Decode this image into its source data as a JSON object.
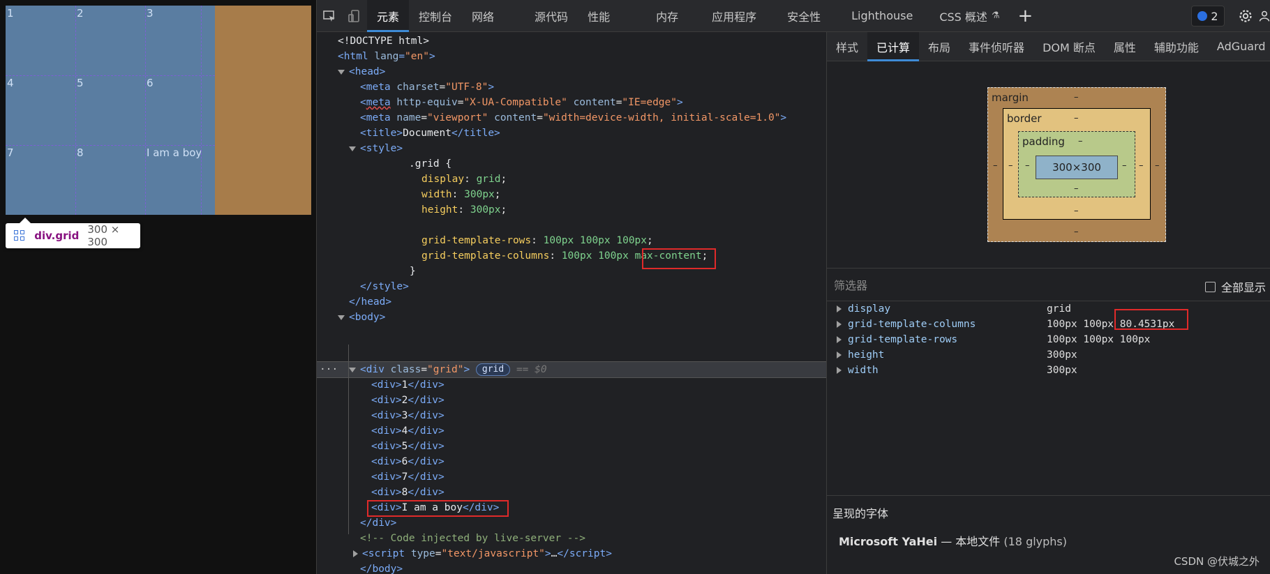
{
  "viewport": {
    "cells": [
      "1",
      "2",
      "3",
      "4",
      "5",
      "6",
      "7",
      "8",
      "I am a boy"
    ],
    "tooltip": {
      "name": "div.grid",
      "size": "300 × 300"
    }
  },
  "toolbar": {
    "tabs": [
      "元素",
      "控制台",
      "网络",
      "源代码",
      "性能",
      "内存",
      "应用程序",
      "安全性",
      "Lighthouse",
      "CSS 概述"
    ],
    "active_tab": "元素",
    "messages_count": "2"
  },
  "dom": {
    "doctype": "<!DOCTYPE html>",
    "html_open": "html",
    "html_lang_attr": "lang",
    "html_lang_val": "\"en\"",
    "meta1_attr": "charset",
    "meta1_val": "\"UTF-8\"",
    "meta2_attr1": "http-equiv",
    "meta2_val1": "\"X-UA-Compatible\"",
    "meta2_attr2": "content",
    "meta2_val2": "\"IE=edge\"",
    "meta3_attr1": "name",
    "meta3_val1": "\"viewport\"",
    "meta3_attr2": "content",
    "meta3_val2": "\"width=device-width, initial-scale=1.0\"",
    "title_text": "Document",
    "css_selector": ".grid {",
    "css": [
      {
        "prop": "display",
        "val": "grid"
      },
      {
        "prop": "width",
        "val": "300px"
      },
      {
        "prop": "height",
        "val": "300px"
      },
      {
        "prop": "grid-template-rows",
        "val": "100px 100px 100px"
      },
      {
        "prop": "grid-template-columns",
        "val": "100px 100px",
        "extra": "max-content"
      }
    ],
    "css_close": "}",
    "div_class_val": "\"grid\"",
    "grid_badge": "grid",
    "eq_text": "== $0",
    "children": [
      "1",
      "2",
      "3",
      "4",
      "5",
      "6",
      "7",
      "8",
      "I am a boy"
    ],
    "comment": "<!-- Code injected by live-server -->",
    "script_type_val": "\"text/javascript\"",
    "ellipsis": "…"
  },
  "side": {
    "tabs": [
      "样式",
      "已计算",
      "布局",
      "事件侦听器",
      "DOM 断点",
      "属性",
      "辅助功能",
      "AdGuard"
    ],
    "active_tab": "已计算",
    "boxmodel": {
      "margin": "margin",
      "border": "border",
      "padding": "padding",
      "content": "300×300",
      "dash": "–"
    },
    "filter_placeholder": "筛选器",
    "show_all": "全部显示",
    "props": [
      {
        "name": "display",
        "value": "grid"
      },
      {
        "name": "grid-template-columns",
        "value": "100px 100px",
        "extra": "80.4531px"
      },
      {
        "name": "grid-template-rows",
        "value": "100px 100px 100px"
      },
      {
        "name": "height",
        "value": "300px"
      },
      {
        "name": "width",
        "value": "300px"
      }
    ],
    "fonts_header": "呈现的字体",
    "font_name": "Microsoft YaHei",
    "font_sep": " — 本地文件 ",
    "font_glyphs": "(18 glyphs)"
  },
  "watermark": "CSDN @伏城之外",
  "colors": {
    "accent": "#3e8bd6",
    "highlight": "#e02a2a",
    "grid_bg": "#5a7da1",
    "page_bg": "#a77c4a"
  }
}
